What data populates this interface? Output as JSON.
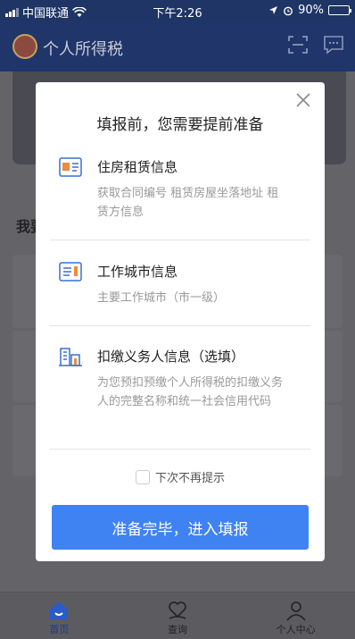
{
  "status_bar": {
    "carrier": "中国联通",
    "time": "下午2:26",
    "battery": "90%",
    "battery_level": 0.9
  },
  "header": {
    "title": "个人所得税"
  },
  "background_page": {
    "section_heading_partial": "我要"
  },
  "modal": {
    "title": "填报前，您需要提前准备",
    "items": [
      {
        "icon": "lease-document-icon",
        "title": "住房租赁信息",
        "description": "获取合同编号 租赁房屋坐落地址 租赁方信息"
      },
      {
        "icon": "work-city-icon",
        "title": "工作城市信息",
        "description": "主要工作城市（市一级）"
      },
      {
        "icon": "withholding-agent-icon",
        "title": "扣缴义务人信息（选填）",
        "description": "为您预扣预缴个人所得税的扣缴义务人的完整名称和统一社会信用代码"
      }
    ],
    "dont_show_again": "下次不再提示",
    "confirm_button": "准备完毕，进入填报"
  },
  "tabbar": {
    "tabs": [
      {
        "label": "首页",
        "icon": "home-icon",
        "active": true
      },
      {
        "label": "查询",
        "icon": "heart-hand-icon",
        "active": false
      },
      {
        "label": "个人中心",
        "icon": "user-icon",
        "active": false
      }
    ]
  },
  "colors": {
    "primary": "#3f82f2",
    "header_bg": "#20356a",
    "icon_blue": "#3a6fd1",
    "icon_orange": "#f08a3c"
  }
}
